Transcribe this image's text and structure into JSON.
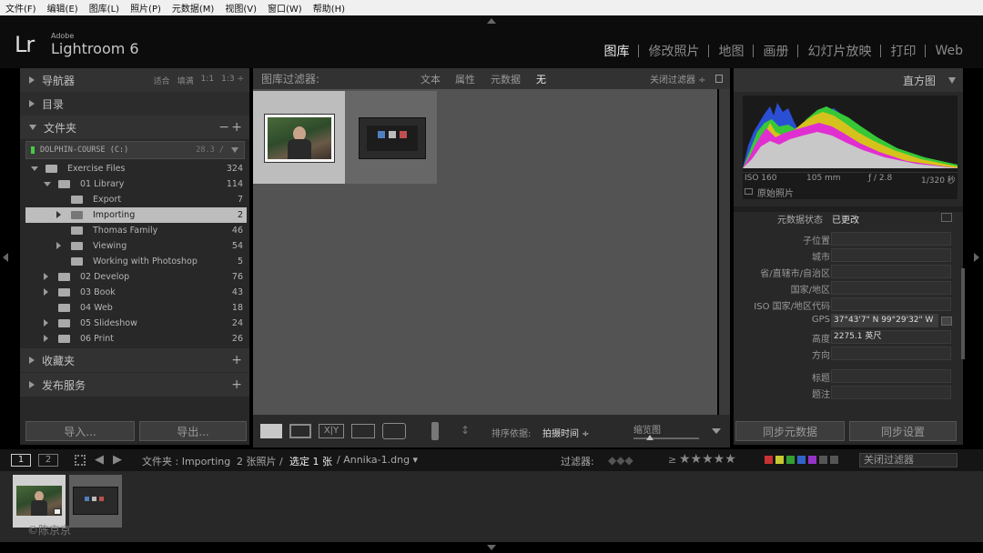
{
  "menu": [
    "文件(F)",
    "编辑(E)",
    "图库(L)",
    "照片(P)",
    "元数据(M)",
    "视图(V)",
    "窗口(W)",
    "帮助(H)"
  ],
  "logo": {
    "lr": "Lr",
    "adobe": "Adobe",
    "app": "Lightroom 6"
  },
  "modules": [
    "图库",
    "修改照片",
    "地图",
    "画册",
    "幻灯片放映",
    "打印",
    "Web"
  ],
  "left": {
    "navigator": {
      "title": "导航器",
      "opts": [
        "适合",
        "填满",
        "1:1",
        "1:3 ÷"
      ]
    },
    "catalog": {
      "title": "目录"
    },
    "folders": {
      "title": "文件夹",
      "minus": "−",
      "plus": "+",
      "volume": {
        "name": "DOLPHIN-COURSE (C:)",
        "stat": "28.3 /"
      },
      "items": [
        {
          "name": "Exercise Files",
          "count": "324"
        },
        {
          "name": "01 Library",
          "count": "114"
        },
        {
          "name": "Export",
          "count": "7"
        },
        {
          "name": "Importing",
          "count": "2"
        },
        {
          "name": "Thomas Family",
          "count": "46"
        },
        {
          "name": "Viewing",
          "count": "54"
        },
        {
          "name": "Working with Photoshop",
          "count": "5"
        },
        {
          "name": "02 Develop",
          "count": "76"
        },
        {
          "name": "03 Book",
          "count": "43"
        },
        {
          "name": "04 Web",
          "count": "18"
        },
        {
          "name": "05 Slideshow",
          "count": "24"
        },
        {
          "name": "06 Print",
          "count": "26"
        }
      ]
    },
    "collections": {
      "title": "收藏夹",
      "plus": "+"
    },
    "publish": {
      "title": "发布服务",
      "plus": "+"
    },
    "import_btn": "导入...",
    "export_btn": "导出..."
  },
  "filter": {
    "label": "图库过滤器:",
    "opts": [
      "文本",
      "属性",
      "元数据",
      "无"
    ],
    "close": "关闭过滤器 ÷"
  },
  "toolbar": {
    "sort_label": "排序依据:",
    "sort_value": "拍摄时间 ÷",
    "thumb_label": "缩览图",
    "xy": "X|Y"
  },
  "right": {
    "histogram_title": "直方图",
    "exif": {
      "iso": "ISO 160",
      "focal": "105 mm",
      "aperture": "ƒ / 2.8",
      "shutter": "1/320 秒"
    },
    "original": "原始照片",
    "meta_status_label": "元数据状态",
    "meta_status_value": "已更改",
    "fields": [
      {
        "label": "子位置",
        "value": ""
      },
      {
        "label": "城市",
        "value": ""
      },
      {
        "label": "省/直辖市/自治区",
        "value": ""
      },
      {
        "label": "国家/地区",
        "value": ""
      },
      {
        "label": "ISO 国家/地区代码",
        "value": ""
      },
      {
        "label": "GPS",
        "value": "37°43'7\" N 99°29'32\" W"
      },
      {
        "label": "高度",
        "value": "2275.1 英尺"
      },
      {
        "label": "方向",
        "value": ""
      },
      {
        "label": "标题",
        "value": ""
      },
      {
        "label": "题注",
        "value": ""
      }
    ],
    "sync_meta": "同步元数据",
    "sync_settings": "同步设置"
  },
  "filmstrip": {
    "page1": "1",
    "page2": "2",
    "source": "文件夹 : Importing",
    "info": "2 张照片 /",
    "selected": "选定 1 张",
    "file": "/ Annika-1.dng ▾",
    "filter_label": "过滤器:",
    "ge": "≥",
    "stars": "★★★★★",
    "close_filter": "关闭过滤器",
    "watermark": "©陈京京"
  },
  "colors": {
    "accent": "#e0e0e0",
    "labels": [
      "#c83232",
      "#c8c832",
      "#32a032",
      "#3264c8",
      "#9632c8"
    ]
  }
}
